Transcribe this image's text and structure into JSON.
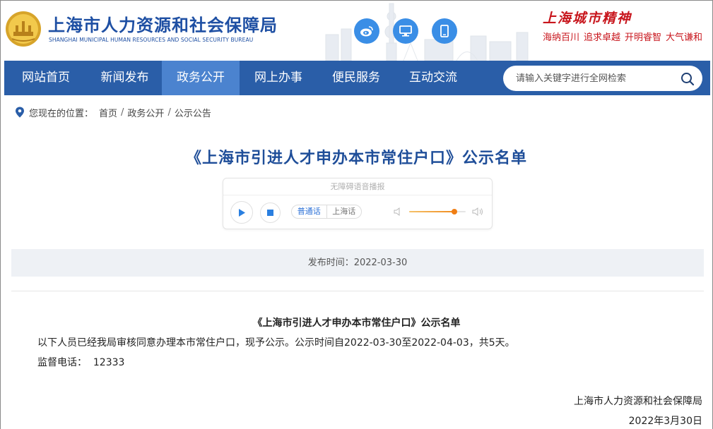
{
  "header": {
    "site_title": "上海市人力资源和社会保障局",
    "site_subtitle": "SHANGHAI MUNICIPAL HUMAN RESOURCES AND SOCIAL SECURITY BUREAU",
    "social_icons": [
      "weibo-icon",
      "desktop-icon",
      "mobile-icon"
    ],
    "city_spirit": {
      "title": "上海城市精神",
      "items": [
        "海纳百川",
        "追求卓越",
        "开明睿智",
        "大气谦和"
      ]
    }
  },
  "nav": {
    "items": [
      {
        "label": "网站首页",
        "active": false
      },
      {
        "label": "新闻发布",
        "active": false
      },
      {
        "label": "政务公开",
        "active": true
      },
      {
        "label": "网上办事",
        "active": false
      },
      {
        "label": "便民服务",
        "active": false
      },
      {
        "label": "互动交流",
        "active": false
      }
    ],
    "search": {
      "placeholder": "请输入关键字进行全网检索",
      "value": ""
    }
  },
  "breadcrumb": {
    "prefix": "您现在的位置：",
    "items": [
      "首页",
      "政务公开",
      "公示公告"
    ],
    "separator": "/"
  },
  "article": {
    "title": "《上海市引进人才申办本市常住户口》公示名单",
    "publish_label": "发布时间：",
    "publish_date": "2022-03-30",
    "content_title": "《上海市引进人才申办本市常住户口》公示名单",
    "paragraph": "以下人员已经我局审核同意办理本市常住户口，现予公示。公示时间自2022-03-30至2022-04-03，共5天。",
    "phone_line": "监督电话：  12333",
    "signature": "上海市人力资源和社会保障局",
    "sign_date": "2022年3月30日"
  },
  "player": {
    "header": "无障碍语音播报",
    "lang_options": [
      "普通话",
      "上海话"
    ],
    "active_lang": "普通话",
    "volume": 0.8
  },
  "colors": {
    "nav_bg": "#2a5ea8",
    "nav_active": "#4b83cf",
    "title_blue": "#1f4e99",
    "accent_red": "#c8161d",
    "volume_orange": "#f07e14"
  }
}
